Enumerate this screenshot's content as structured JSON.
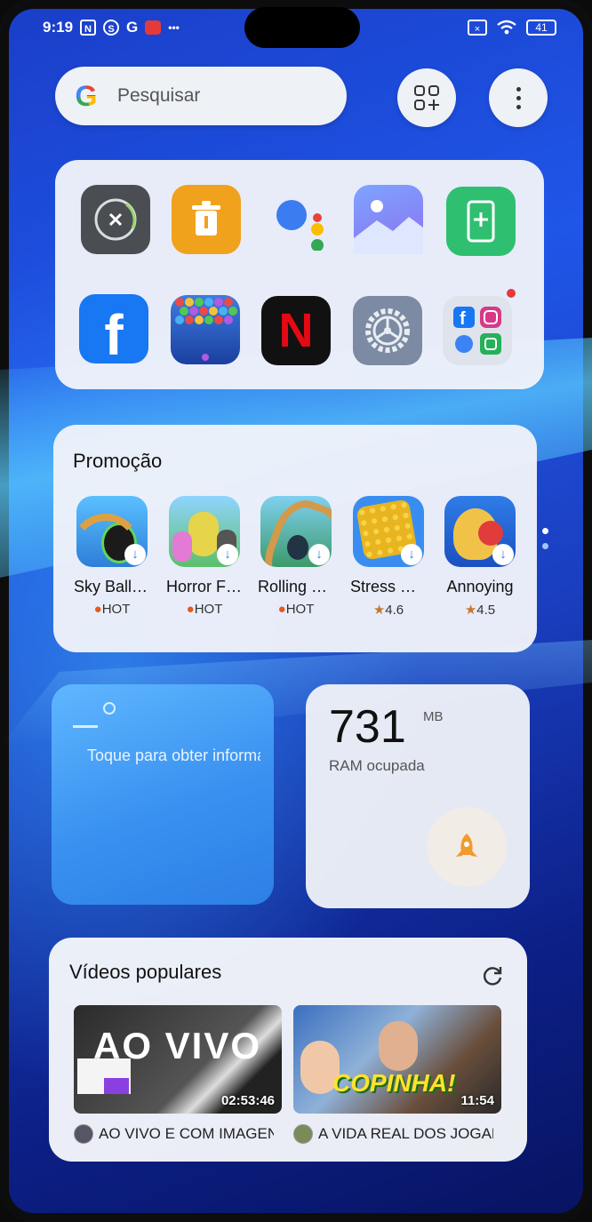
{
  "status": {
    "time": "9:19",
    "notif_letters": [
      "N",
      "S",
      "G"
    ],
    "more": "•••",
    "battery": "41"
  },
  "search": {
    "placeholder": "Pesquisar",
    "logo": "G"
  },
  "apps": [
    {
      "icon": "close-circle-icon"
    },
    {
      "icon": "trash-icon"
    },
    {
      "icon": "assistant-icon"
    },
    {
      "icon": "gallery-icon"
    },
    {
      "icon": "phone-clone-icon"
    },
    {
      "icon": "facebook-icon",
      "glyph": "f"
    },
    {
      "icon": "bubble-shooter-icon"
    },
    {
      "icon": "netflix-icon",
      "glyph": "N"
    },
    {
      "icon": "settings-icon"
    },
    {
      "icon": "social-folder-icon"
    }
  ],
  "promo": {
    "title": "Promoção",
    "games": [
      {
        "name": "Sky Ball Jump",
        "rating": "HOT",
        "type": "hot"
      },
      {
        "name": "Horror Friends",
        "rating": "HOT",
        "type": "hot"
      },
      {
        "name": "Rolling Ball",
        "rating": "HOT",
        "type": "hot"
      },
      {
        "name": "Stress Relief",
        "rating": "4.6",
        "type": "star"
      },
      {
        "name": "Annoying",
        "rating": "4.5",
        "type": "star"
      }
    ]
  },
  "weather": {
    "text": "Toque para obter informações"
  },
  "ram": {
    "value": "731",
    "unit": "MB",
    "label": "RAM ocupada"
  },
  "videos": {
    "title": "Vídeos populares",
    "items": [
      {
        "overlay": "AO VIVO",
        "duration": "02:53:46",
        "label": "AO VIVO E COM IMAGENS"
      },
      {
        "overlay": "COPINHA!",
        "duration": "11:54",
        "label": "A VIDA REAL DOS JOGADORES"
      }
    ]
  }
}
